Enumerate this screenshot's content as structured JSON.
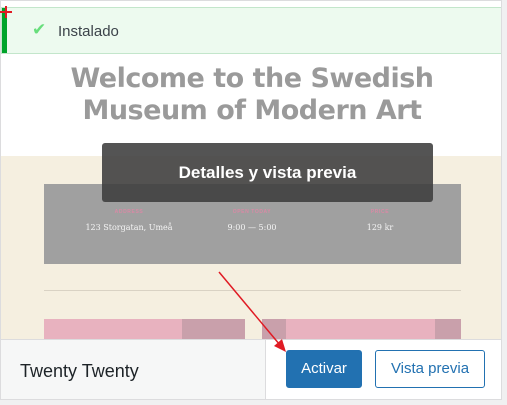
{
  "notice": {
    "text": "Instalado",
    "check_icon": "check-icon",
    "accent_color": "#00a32a"
  },
  "theme_screenshot": {
    "title_line1": "Welcome to the Swedish",
    "title_line2": "Museum of Modern Art",
    "info": [
      {
        "label": "ADDRESS",
        "value": "123 Storgatan, Umeå"
      },
      {
        "label": "OPEN TODAY",
        "value": "9:00 — 5:00"
      },
      {
        "label": "PRICE",
        "value": "129 kr"
      }
    ]
  },
  "overlay": {
    "label": "Detalles y vista previa"
  },
  "footer": {
    "theme_name": "Twenty Twenty",
    "activate_label": "Activar",
    "preview_label": "Vista previa",
    "primary_color": "#2271b1"
  }
}
